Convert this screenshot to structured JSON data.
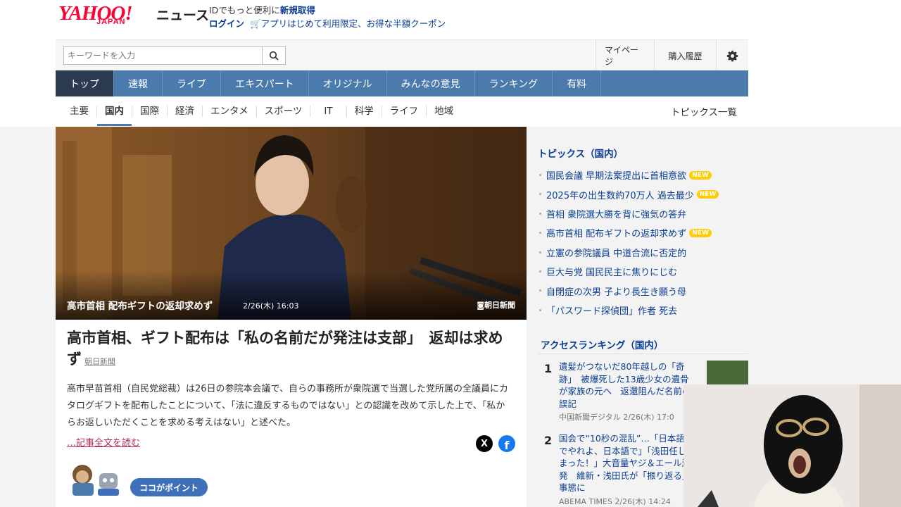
{
  "header": {
    "logo": "YAHOO!",
    "logo_sub": "JAPAN",
    "service": "ニュース",
    "promo_line1_pre": "IDでもっと便利に",
    "promo_line1_link": "新規取得",
    "login": "ログイン",
    "promo_line2": "アプリはじめて利用限定、お得な半額クーポン",
    "search_placeholder": "キーワードを入力",
    "mypage": "マイページ",
    "purchase_history": "購入履歴"
  },
  "global_nav": {
    "tabs": [
      "トップ",
      "速報",
      "ライブ",
      "エキスパート",
      "オリジナル",
      "みんなの意見",
      "ランキング",
      "有料"
    ],
    "active": "トップ"
  },
  "sub_nav": {
    "tabs": [
      "主要",
      "国内",
      "国際",
      "経済",
      "エンタメ",
      "スポーツ",
      "IT",
      "科学",
      "ライフ",
      "地域"
    ],
    "active": "国内",
    "topics_all": "トピックス一覧"
  },
  "article": {
    "image_caption": "高市首相 配布ギフトの返却求めず",
    "image_date": "2/26(木) 16:03",
    "image_credit": "朝日新聞",
    "headline": "高市首相、ギフト配布は「私の名前だが発注は支部」　返却は求めず",
    "source": "朝日新聞",
    "lead": "高市早苗首相（自民党総裁）は26日の参院本会議で、自らの事務所が衆院選で当選した党所属の全議員にカタログギフトを配布したことについて、「法に違反するものではない」との認識を改めて示した上で、「私からお返しいただくことを求める考えはない」と述べた。",
    "read_more": "…記事全文を読む",
    "share_x": "X",
    "share_facebook": "f",
    "point_label": "ココがポイント"
  },
  "sidebar": {
    "topics_heading": "トピックス（国内）",
    "topics": [
      {
        "text": "国民会議 早期法案提出に首相意欲",
        "new": "NEW"
      },
      {
        "text": "2025年の出生数約70万人 過去最少",
        "new": "NEW"
      },
      {
        "text": "首相 衆院選大勝を背に強気の答弁",
        "new": ""
      },
      {
        "text": "高市首相 配布ギフトの返却求めず",
        "new": "NEW"
      },
      {
        "text": "立憲の参院議員 中道合流に否定的",
        "new": ""
      },
      {
        "text": "巨大与党 国民民主に焦りにじむ",
        "new": ""
      },
      {
        "text": "自閉症の次男 子より長生き願う母",
        "new": ""
      },
      {
        "text": "「パスワード探偵団」作者 死去",
        "new": ""
      }
    ],
    "ranking_heading": "アクセスランキング（国内）",
    "ranking": [
      {
        "rank": "1",
        "title": "遺髪がつないだ80年越しの「奇跡」　被爆死した13歳少女の遺骨が家族の元へ　返還阻んだ名前の誤記",
        "source": "中国新聞デジタル 2/26(木) 17:0"
      },
      {
        "rank": "2",
        "title": "国会で“10秒の混乱”…「日本語でやれよ、日本語で」「浅田任しまった！」大音量ヤジ＆エール連発　維新・浅田氏が「振り返る」事態に",
        "source": "ABEMA TIMES 2/26(木) 14:24"
      }
    ]
  },
  "colors": {
    "brand_red": "#ff0033",
    "nav_blue": "#4a7bac",
    "nav_active": "#2b3a4e",
    "link_blue": "#0a3d91",
    "read_more": "#b02a52",
    "new_badge": "#ffcc00"
  }
}
